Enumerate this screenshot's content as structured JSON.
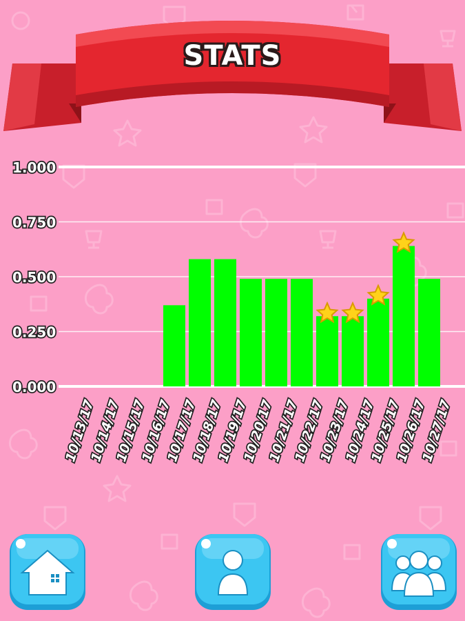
{
  "header": {
    "title": "STATS"
  },
  "nav": {
    "home_icon": "house-icon",
    "profile_icon": "person-icon",
    "friends_icon": "group-icon"
  },
  "colors": {
    "background": "#fc9fc7",
    "bar": "#00ff00",
    "banner": "#e4262f",
    "button": "#3cc6f2",
    "star": "#ffd21a"
  },
  "chart_data": {
    "type": "bar",
    "title": "",
    "xlabel": "",
    "ylabel": "",
    "ylim": [
      0,
      1
    ],
    "yticks": [
      "1.000",
      "0.750",
      "0.500",
      "0.250",
      "0.000"
    ],
    "grid": true,
    "categories": [
      "10/13/17",
      "10/14/17",
      "10/15/17",
      "10/16/17",
      "10/17/17",
      "10/18/17",
      "10/19/17",
      "10/20/17",
      "10/21/17",
      "10/22/17",
      "10/23/17",
      "10/24/17",
      "10/25/17",
      "10/26/17",
      "10/27/17"
    ],
    "values": [
      0,
      0,
      0,
      0.37,
      0.58,
      0.58,
      0.49,
      0.49,
      0.49,
      0.32,
      0.32,
      0.4,
      0.64,
      0.49,
      0
    ],
    "starred": [
      false,
      false,
      false,
      false,
      false,
      false,
      false,
      false,
      false,
      true,
      true,
      true,
      true,
      false,
      false
    ]
  }
}
